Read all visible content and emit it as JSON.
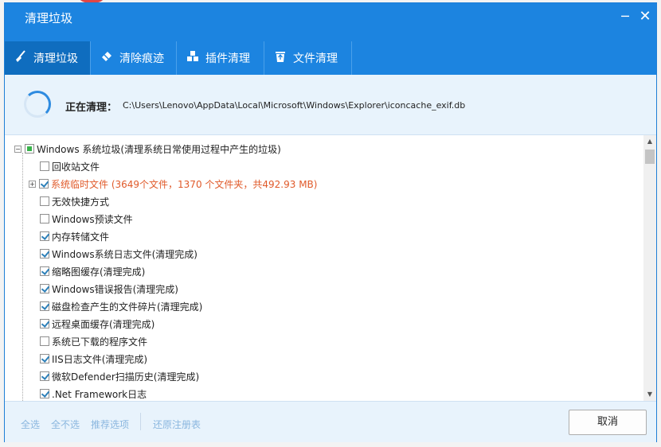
{
  "window": {
    "title": "清理垃圾",
    "minimize_glyph": "─",
    "close_glyph": "✕"
  },
  "tabs": [
    {
      "label": "清理垃圾",
      "icon": "broom-icon",
      "active": true
    },
    {
      "label": "清除痕迹",
      "icon": "eraser-icon",
      "active": false
    },
    {
      "label": "插件清理",
      "icon": "plugin-icon",
      "active": false
    },
    {
      "label": "文件清理",
      "icon": "trash-icon",
      "active": false
    }
  ],
  "progress": {
    "label": "正在清理：",
    "path": "C:\\Users\\Lenovo\\AppData\\Local\\Microsoft\\Windows\\Explorer\\iconcache_exif.db"
  },
  "tree": {
    "root": {
      "label": "Windows 系统垃圾(清理系统日常使用过程中产生的垃圾)",
      "state": "partial",
      "expander": "−"
    },
    "items": [
      {
        "label": "回收站文件",
        "checked": false
      },
      {
        "label": "系统临时文件 (3649个文件，1370 个文件夹，共492.93 MB)",
        "checked": true,
        "warn": true,
        "expander": "+"
      },
      {
        "label": "无效快捷方式",
        "checked": false
      },
      {
        "label": "Windows预读文件",
        "checked": false
      },
      {
        "label": "内存转储文件",
        "checked": true
      },
      {
        "label": "Windows系统日志文件(清理完成)",
        "checked": true
      },
      {
        "label": "缩略图缓存(清理完成)",
        "checked": true
      },
      {
        "label": "Windows错误报告(清理完成)",
        "checked": true
      },
      {
        "label": "磁盘检查产生的文件碎片(清理完成)",
        "checked": true
      },
      {
        "label": "远程桌面缓存(清理完成)",
        "checked": true
      },
      {
        "label": "系统已下载的程序文件",
        "checked": false
      },
      {
        "label": "IIS日志文件(清理完成)",
        "checked": true
      },
      {
        "label": "微软Defender扫描历史(清理完成)",
        "checked": true
      },
      {
        "label": ".Net Framework日志",
        "checked": true
      }
    ]
  },
  "scrollbar": {
    "up_glyph": "▲",
    "down_glyph": "▼"
  },
  "footer": {
    "select_all": "全选",
    "select_none": "全不选",
    "recommended": "推荐选项",
    "restore_registry": "还原注册表",
    "cancel": "取消"
  },
  "colors": {
    "titlebar": "#1c84e0",
    "active_tab": "#0f6dbf",
    "panel_bg": "#e8f3fc",
    "warn_text": "#e05a2a",
    "disabled_link": "#8bb7df"
  }
}
